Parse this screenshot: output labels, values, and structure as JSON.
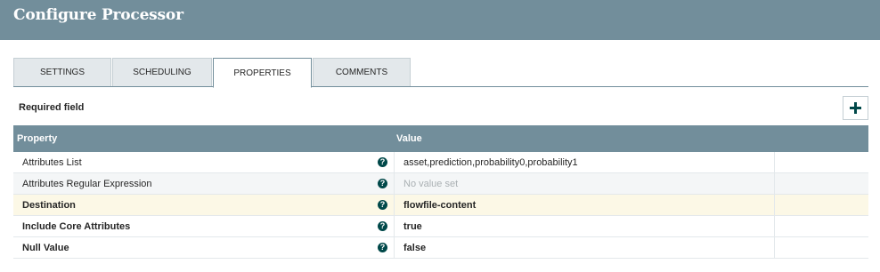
{
  "header": {
    "title": "Configure Processor"
  },
  "tabs": [
    {
      "label": "SETTINGS"
    },
    {
      "label": "SCHEDULING"
    },
    {
      "label": "PROPERTIES",
      "active": true
    },
    {
      "label": "COMMENTS"
    }
  ],
  "properties": {
    "required_label": "Required field",
    "add_icon": "plus-icon",
    "columns": {
      "property": "Property",
      "value": "Value"
    },
    "help_icon_glyph": "?",
    "rows": [
      {
        "name": "Attributes List",
        "value": "asset,prediction,probability0,probability1",
        "required": false
      },
      {
        "name": "Attributes Regular Expression",
        "value": "No value set",
        "required": false,
        "empty": true
      },
      {
        "name": "Destination",
        "value": "flowfile-content",
        "required": true
      },
      {
        "name": "Include Core Attributes",
        "value": "true",
        "required": true
      },
      {
        "name": "Null Value",
        "value": "false",
        "required": true
      }
    ]
  },
  "colors": {
    "header_bg": "#728e9b",
    "required_row_bg": "#fcf8e6",
    "help_icon": "#004849"
  }
}
